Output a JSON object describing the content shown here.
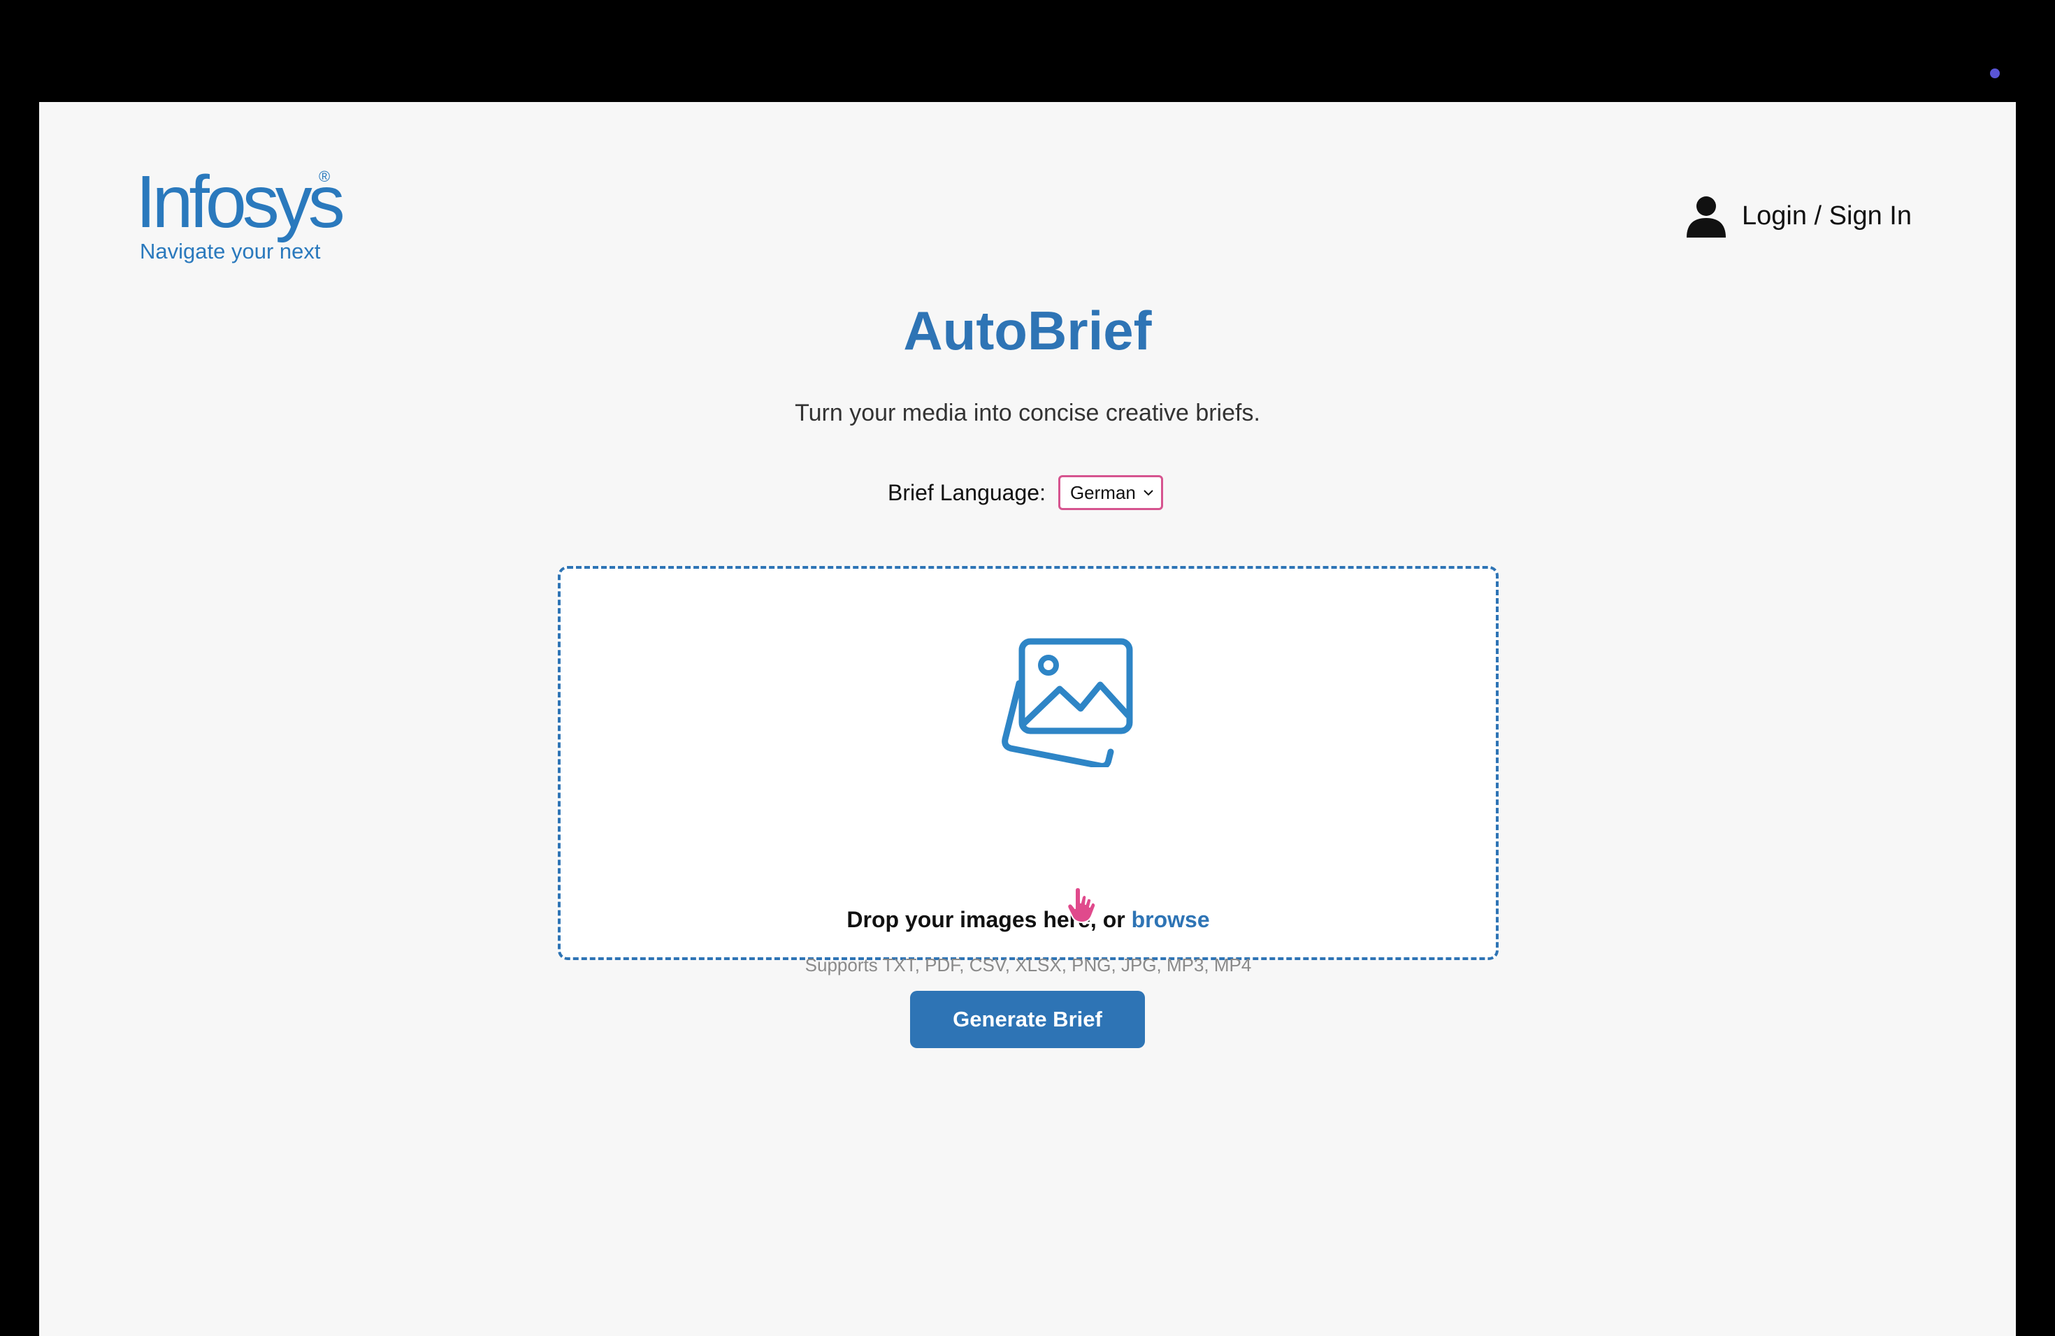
{
  "brand": {
    "logo_text": "Infosys",
    "logo_registered": "®",
    "tagline": "Navigate your next",
    "color": "#2a79bd"
  },
  "header": {
    "login_label": "Login / Sign In",
    "login_icon": "user-icon"
  },
  "main": {
    "title": "AutoBrief",
    "subtitle": "Turn your media into concise creative briefs.",
    "language": {
      "label": "Brief Language:",
      "selected": "German"
    },
    "dropzone": {
      "icon": "images-icon",
      "text_prefix": "Drop your images here, or ",
      "browse_label": "browse",
      "hint": "Supports TXT, PDF, CSV, XLSX, PNG, JPG, MP3, MP4"
    },
    "generate_label": "Generate Brief"
  },
  "colors": {
    "accent": "#2e74b5",
    "select_border": "#d6548f",
    "background": "#f7f7f7"
  }
}
